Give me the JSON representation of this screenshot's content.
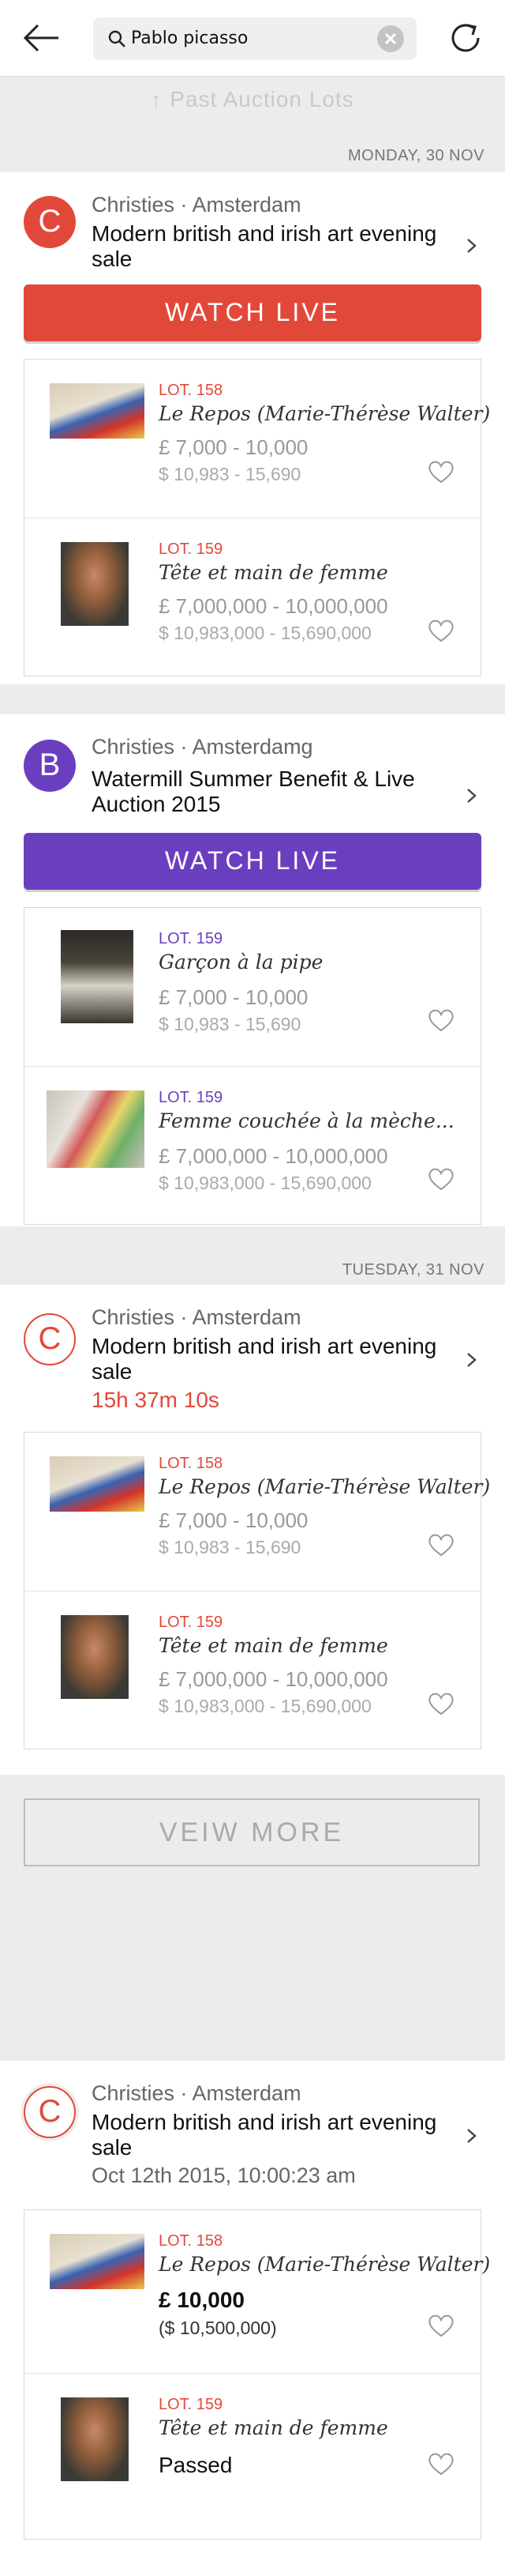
{
  "search": {
    "query": "Pablo picasso"
  },
  "past_auction_lots": "Past Auction Lots",
  "dates": [
    "MONDAY, 30 NOV",
    "TUESDAY, 31 NOV"
  ],
  "accent": {
    "red": "#e2483a",
    "purple": "#6a3fbf"
  },
  "auctions": [
    {
      "logo_letter": "C",
      "house": "Christies · Amsterdam",
      "title": "Modern british and irish art evening sale",
      "watch_label": "WATCH LIVE",
      "lots": [
        {
          "lot": "LOT. 158",
          "title": "Le Repos (Marie-Thérèse Walter)",
          "gbp": "£ 7,000 - 10,000",
          "usd": "$ 10,983 - 15,690"
        },
        {
          "lot": "LOT. 159",
          "title": "Tête et main de femme",
          "gbp": "£ 7,000,000 - 10,000,000",
          "usd": "$ 10,983,000 - 15,690,000"
        }
      ]
    },
    {
      "logo_letter": "B",
      "house": "Christies · Amsterdamg",
      "title": "Watermill Summer Benefit & Live Auction 2015",
      "watch_label": "WATCH LIVE",
      "lots": [
        {
          "lot": "LOT. 159",
          "title": "Garçon à la pipe",
          "gbp": "£ 7,000 - 10,000",
          "usd": "$ 10,983 - 15,690"
        },
        {
          "lot": "LOT. 159",
          "title": "Femme couchée à la mèche...",
          "gbp": "£ 7,000,000 - 10,000,000",
          "usd": "$ 10,983,000 - 15,690,000"
        }
      ]
    },
    {
      "logo_letter": "C",
      "house": "Christies · Amsterdam",
      "title": "Modern british and irish art evening sale",
      "countdown": "15h 37m 10s",
      "lots": [
        {
          "lot": "LOT. 158",
          "title": "Le Repos (Marie-Thérèse Walter)",
          "gbp": "£ 7,000 - 10,000",
          "usd": "$ 10,983 - 15,690"
        },
        {
          "lot": "LOT. 159",
          "title": "Tête et main de femme",
          "gbp": "£ 7,000,000 - 10,000,000",
          "usd": "$ 10,983,000 - 15,690,000"
        }
      ]
    },
    {
      "logo_letter": "C",
      "house": "Christies · Amsterdam",
      "title": "Modern british and irish art evening sale",
      "date_line": "Oct 12th 2015, 10:00:23 am",
      "lots": [
        {
          "lot": "LOT. 158",
          "title": "Le Repos (Marie-Thérèse Walter)",
          "price": "£ 10,000",
          "price_usd": "($ 10,500,000)"
        },
        {
          "lot": "LOT. 159",
          "title": "Tête et main de femme",
          "result": "Passed"
        }
      ]
    }
  ],
  "view_more": "VEIW MORE",
  "icons": [
    "back-arrow-icon",
    "search-icon",
    "clear-icon",
    "refresh-icon",
    "arrow-up-icon",
    "chevron-right-icon",
    "heart-icon"
  ]
}
